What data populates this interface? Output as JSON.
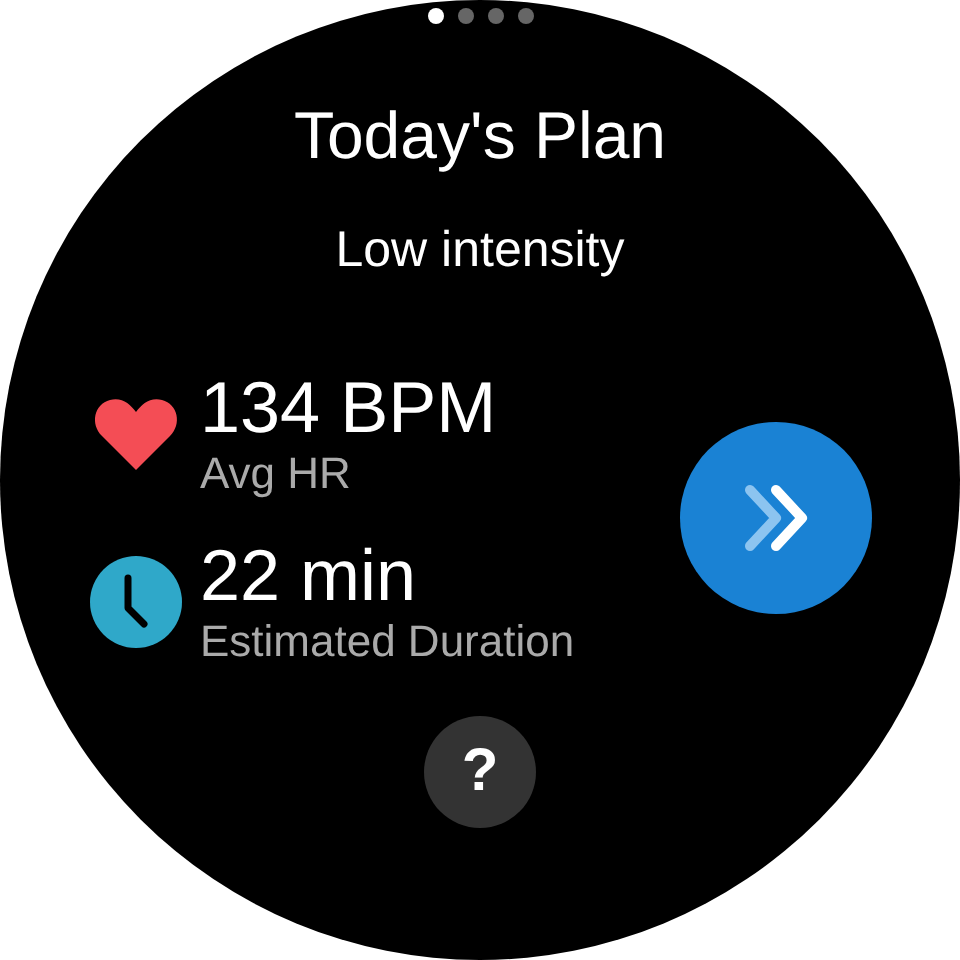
{
  "page_indicator": [
    {
      "selected": true
    },
    {
      "selected": false
    },
    {
      "selected": false
    },
    {
      "selected": false
    }
  ],
  "title": "Today's Plan",
  "subtitle": "Low intensity",
  "stats": [
    {
      "kind": "heart",
      "value": "134 BPM",
      "label": "Avg HR"
    },
    {
      "kind": "clock",
      "value": "22 min",
      "label": "Estimated Duration"
    }
  ],
  "help_button": {
    "label": "?"
  }
}
